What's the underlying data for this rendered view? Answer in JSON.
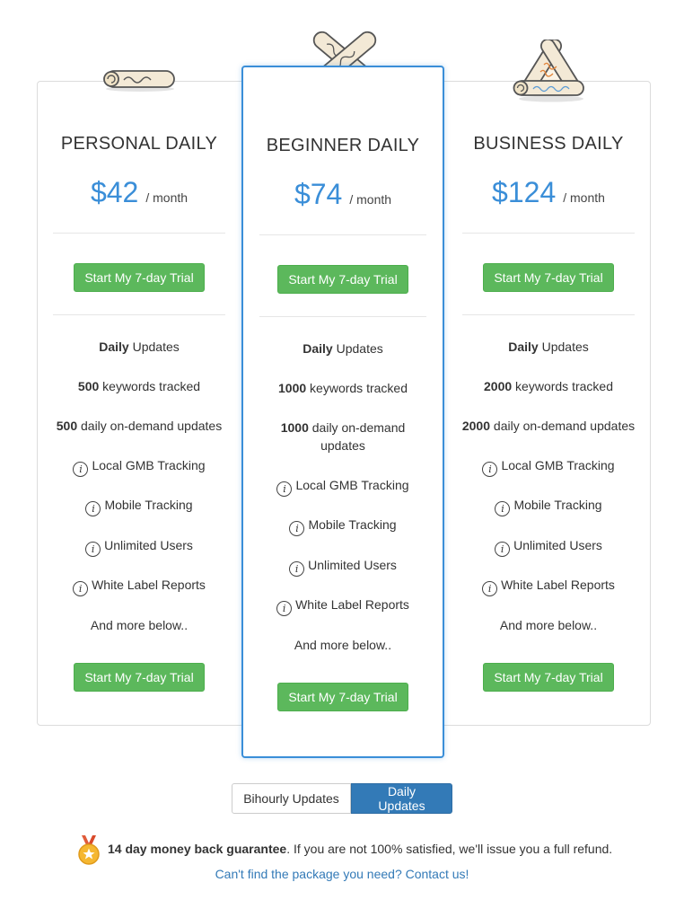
{
  "plans": [
    {
      "title": "PERSONAL DAILY",
      "price": "$42",
      "period": "/ month",
      "cta": "Start My 7-day Trial",
      "features": {
        "updates_bold": "Daily",
        "updates_rest": "Updates",
        "keywords_bold": "500",
        "keywords_rest": "keywords tracked",
        "ondemand_bold": "500",
        "ondemand_rest": "daily on-demand updates",
        "gmb": "Local GMB Tracking",
        "mobile": "Mobile Tracking",
        "users": "Unlimited Users",
        "whitelabel": "White Label Reports",
        "more": "And more below.."
      }
    },
    {
      "title": "BEGINNER DAILY",
      "price": "$74",
      "period": "/ month",
      "cta": "Start My 7-day Trial",
      "features": {
        "updates_bold": "Daily",
        "updates_rest": "Updates",
        "keywords_bold": "1000",
        "keywords_rest": "keywords tracked",
        "ondemand_bold": "1000",
        "ondemand_rest": "daily on-demand",
        "ondemand_rest2": "updates",
        "gmb": "Local GMB Tracking",
        "mobile": "Mobile Tracking",
        "users": "Unlimited Users",
        "whitelabel": "White Label Reports",
        "more": "And more below.."
      }
    },
    {
      "title": "BUSINESS DAILY",
      "price": "$124",
      "period": "/ month",
      "cta": "Start My 7-day Trial",
      "features": {
        "updates_bold": "Daily",
        "updates_rest": "Updates",
        "keywords_bold": "2000",
        "keywords_rest": "keywords tracked",
        "ondemand_bold": "2000",
        "ondemand_rest": "daily on-demand updates",
        "gmb": "Local GMB Tracking",
        "mobile": "Mobile Tracking",
        "users": "Unlimited Users",
        "whitelabel": "White Label Reports",
        "more": "And more below.."
      }
    }
  ],
  "icons": {
    "info": "i",
    "medal": "medal-icon",
    "scroll": "scroll-icon"
  },
  "toggle": {
    "bihourly": "Bihourly Updates",
    "daily": "Daily Updates",
    "selected": "daily"
  },
  "guarantee": {
    "bold": "14 day money back guarantee",
    "rest": ". If you are not 100% satisfied, we'll issue you a full refund."
  },
  "contact": {
    "link": "Can't find the package you need? Contact us",
    "suffix": "!"
  },
  "colors": {
    "accent": "#3a8ed8",
    "cta": "#5cb85c",
    "toggle_active": "#337ab7"
  }
}
